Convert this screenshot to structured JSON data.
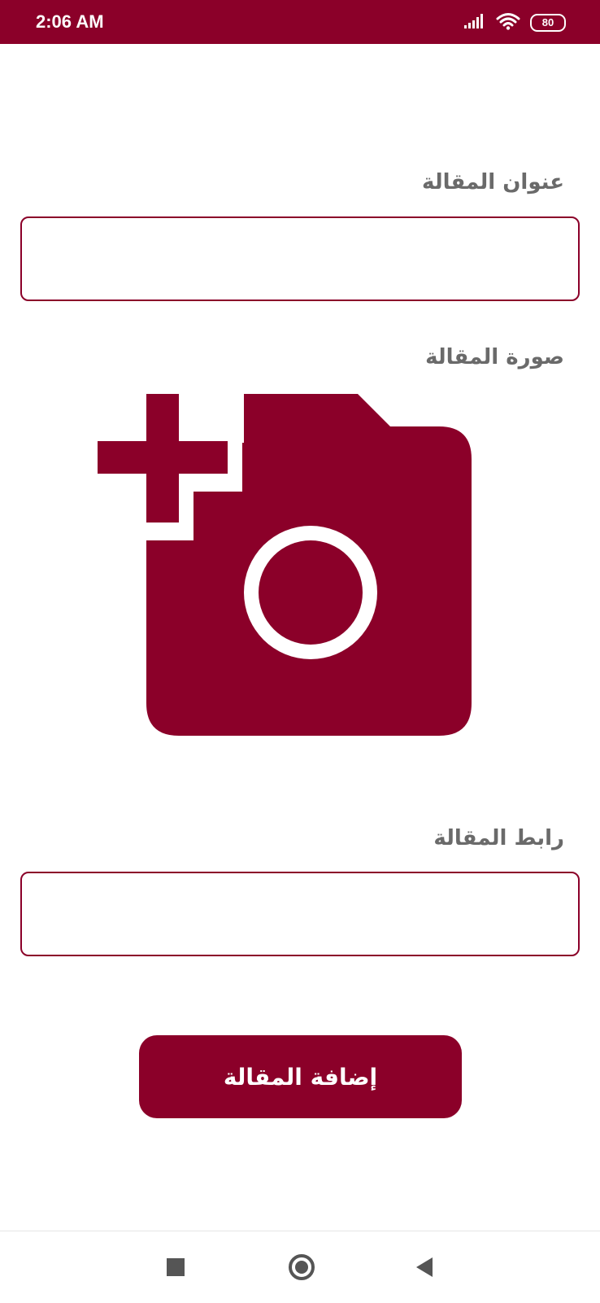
{
  "status_bar": {
    "time": "2:06 AM",
    "battery": "80",
    "icons": [
      "signal-icon",
      "wifi-icon",
      "battery-icon"
    ]
  },
  "form": {
    "title_label": "عنوان المقالة",
    "title_value": "",
    "image_label": "صورة المقالة",
    "image_picker_icon": "add-photo-camera-icon",
    "link_label": "رابط المقالة",
    "link_value": "",
    "submit_label": "إضافة المقالة"
  },
  "nav_bar": {
    "buttons": [
      "recents-square-icon",
      "home-circle-icon",
      "back-triangle-icon"
    ]
  },
  "colors": {
    "primary": "#8b0029",
    "label": "#6a6a6a",
    "background": "#ffffff",
    "nav_icon": "#555555"
  }
}
